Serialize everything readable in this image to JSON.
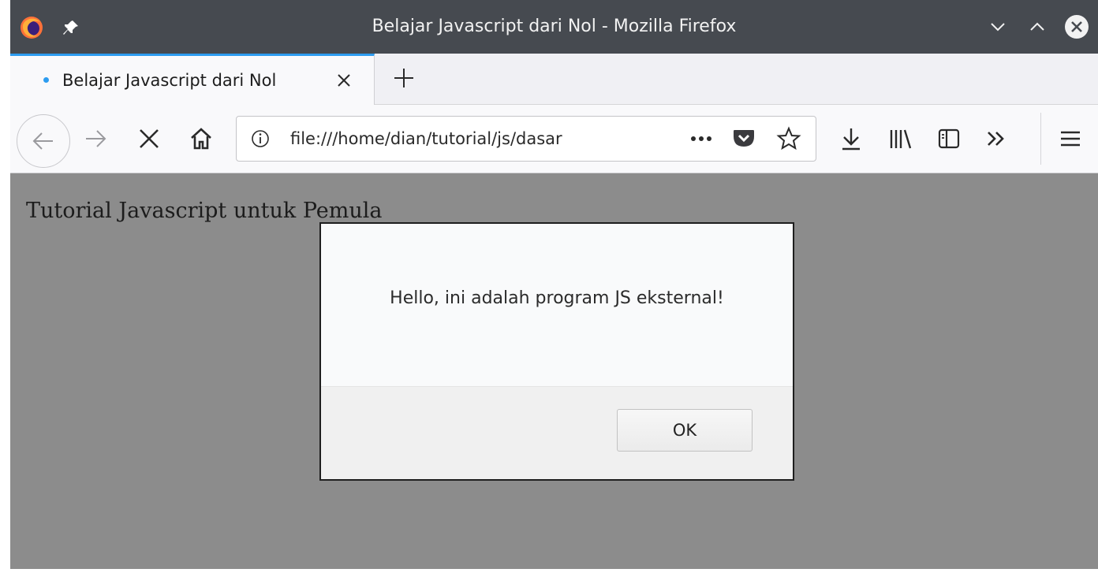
{
  "window": {
    "title": "Belajar Javascript dari Nol - Mozilla Firefox",
    "controls": [
      "minimize-icon",
      "maximize-icon",
      "close-icon"
    ]
  },
  "tabs": [
    {
      "label": "Belajar Javascript dari Nol",
      "active": true,
      "loading": true
    }
  ],
  "navbar": {
    "url": "file:///home/dian/tutorial/js/dasar",
    "icons": [
      "back-icon",
      "forward-icon",
      "stop-icon",
      "home-icon",
      "info-icon",
      "more-icon",
      "pocket-icon",
      "bookmark-star-icon",
      "download-icon",
      "library-icon",
      "sidebar-icon",
      "overflow-icon",
      "menu-icon"
    ]
  },
  "page": {
    "heading": "Tutorial Javascript untuk Pemula"
  },
  "dialog": {
    "message": "Hello, ini adalah program JS eksternal!",
    "ok_label": "OK"
  },
  "colors": {
    "titlebar": "#464a50",
    "tab_accent": "#2d9cf0",
    "overlay": "#8c8c8c"
  }
}
